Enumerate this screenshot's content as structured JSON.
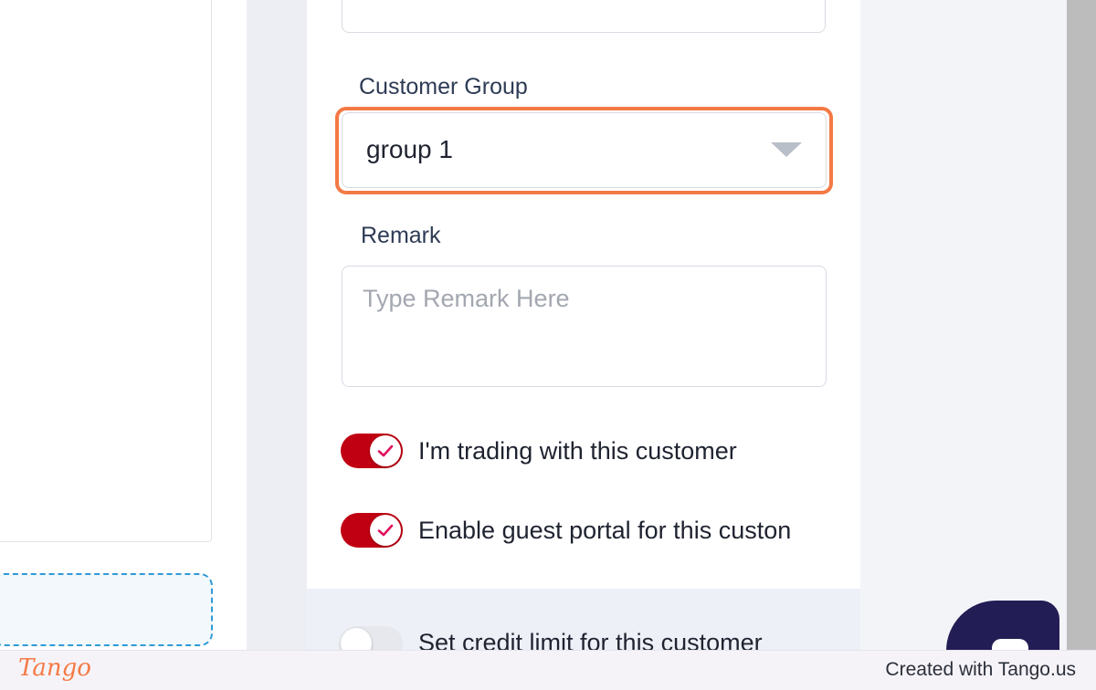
{
  "form": {
    "customer_group_label": "Customer Group",
    "customer_group_value": "group 1",
    "remark_label": "Remark",
    "remark_placeholder": "Type Remark Here",
    "remark_value": "",
    "toggles": [
      {
        "label": "I'm trading with this customer",
        "on": true
      },
      {
        "label": "Enable guest portal for this custon",
        "on": true
      },
      {
        "label": "Set credit limit for this customer",
        "on": false
      }
    ]
  },
  "colors": {
    "highlight": "#f47a45",
    "toggle_on": "#c00012",
    "check": "#e0115f",
    "chat": "#231d55"
  },
  "footer": {
    "brand": "Tango",
    "credit": "Created with Tango.us"
  }
}
